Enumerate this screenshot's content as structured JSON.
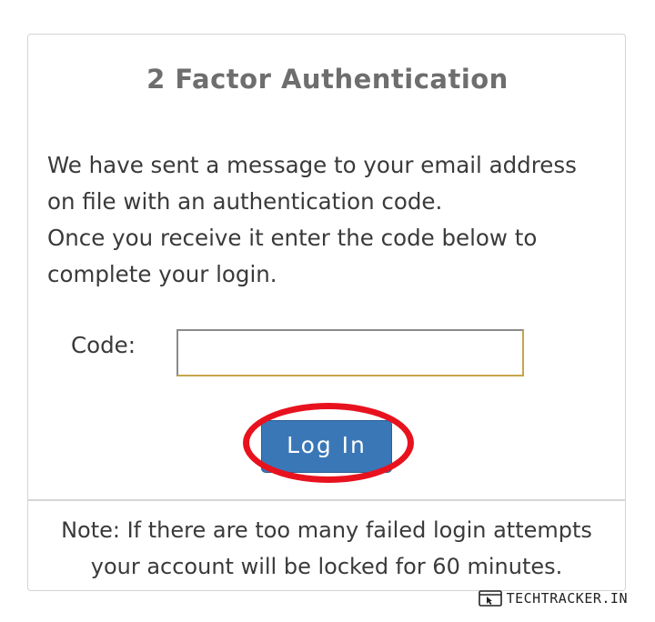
{
  "dialog": {
    "title": "2 Factor Authentication",
    "message_lines": [
      "We have sent a message to your email address",
      "on file with an authentication code.",
      "Once you receive it enter the code below to",
      "complete your login."
    ],
    "code_label": "Code:",
    "code_value": "",
    "login_label": "Log In",
    "note_lines": [
      "Note: If there are too many failed login attempts",
      "your account will be locked for 60 minutes."
    ]
  },
  "annotation": {
    "ring_color": "#e8121e"
  },
  "watermark": {
    "text": "TECHTRACKER.IN",
    "icon": "cursor-window-icon"
  },
  "colors": {
    "button": "#3a77b7",
    "title": "#6e6e6e",
    "input_border": "#c7a64a"
  }
}
